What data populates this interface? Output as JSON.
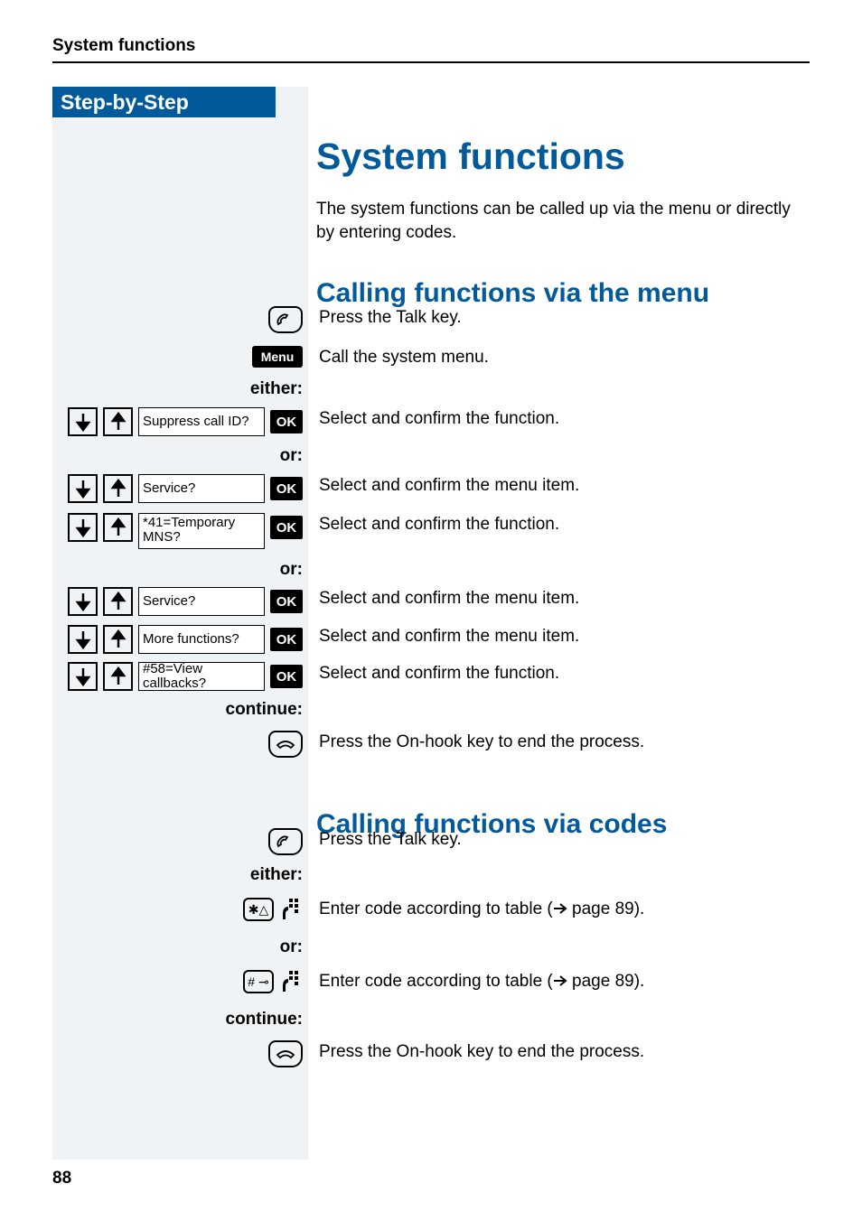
{
  "header": {
    "title": "System functions"
  },
  "sidebar": {
    "title": "Step-by-Step"
  },
  "main": {
    "title": "System functions",
    "intro": "The system functions can be called up via the menu or directly by entering codes."
  },
  "section1": {
    "title": "Calling functions via the menu",
    "talk": "Press the Talk key.",
    "menu_key": "Menu",
    "menu_desc": "Call the system menu.",
    "either": "either:",
    "or": "or:",
    "continue": "continue:",
    "step_suppress": {
      "label": "Suppress call ID?",
      "ok": "OK",
      "desc": "Select and confirm the function."
    },
    "step_service1": {
      "label": "Service?",
      "ok": "OK",
      "desc": "Select and confirm the menu item."
    },
    "step_temp": {
      "label": "*41=Temporary MNS?",
      "ok": "OK",
      "desc": "Select and confirm the function."
    },
    "step_service2": {
      "label": "Service?",
      "ok": "OK",
      "desc": "Select and confirm the menu item."
    },
    "step_more": {
      "label": "More functions?",
      "ok": "OK",
      "desc": "Select and confirm the menu item."
    },
    "step_callbacks": {
      "label": "#58=View callbacks?",
      "ok": "OK",
      "desc": "Select and confirm the function."
    },
    "onhook": "Press the On-hook key to end the process."
  },
  "section2": {
    "title": "Calling functions via codes",
    "talk": "Press the Talk key.",
    "either": "either:",
    "code1_pre": "Enter code according to table (",
    "code1_ref": " page 89).",
    "or": "or:",
    "code2_pre": "Enter code according to table (",
    "code2_ref": " page 89).",
    "continue": "continue:",
    "onhook": "Press the On-hook key to end the process."
  },
  "page_number": "88"
}
